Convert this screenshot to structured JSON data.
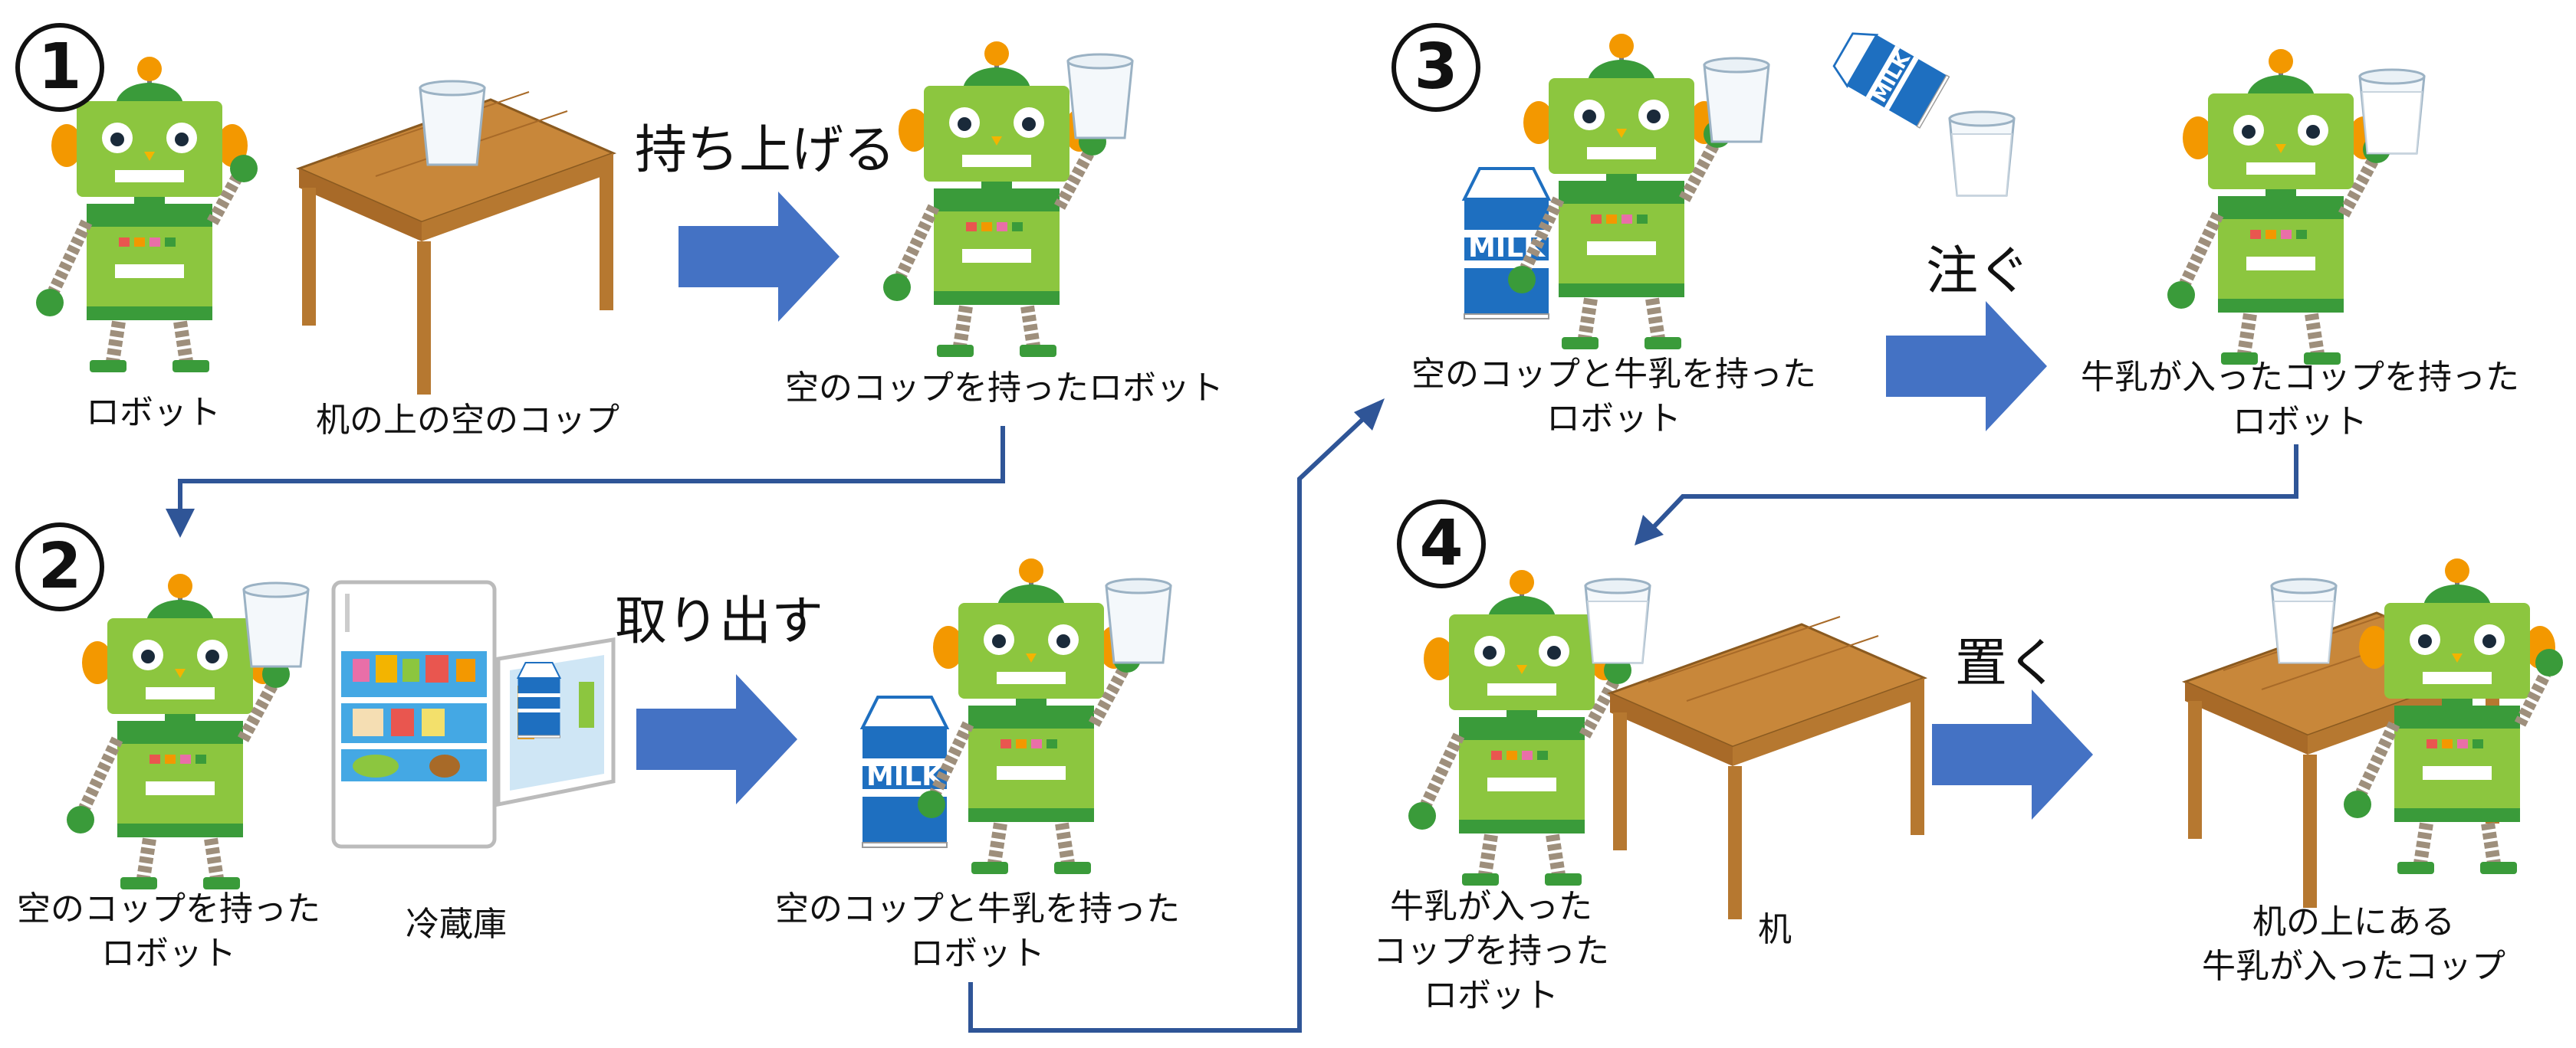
{
  "steps": {
    "s1": "1",
    "s2": "2",
    "s3": "3",
    "s4": "4"
  },
  "verbs": {
    "lift": "持ち上げる",
    "take_out": "取り出す",
    "pour": "注ぐ",
    "place": "置く"
  },
  "labels": {
    "robot": "ロボット",
    "empty_cup_on_desk": "机の上の空のコップ",
    "robot_with_empty_cup": "空のコップを持ったロボット",
    "robot_with_empty_cup_2": "空のコップを持った\nロボット",
    "fridge": "冷蔵庫",
    "robot_with_cup_and_milk": "空のコップと牛乳を持った\nロボット",
    "robot_with_cup_and_milk_3": "空のコップと牛乳を持った\nロボット",
    "robot_with_milk_cup": "牛乳が入ったコップを持った\nロボット",
    "robot_with_milk_cup_4": "牛乳が入った\nコップを持った\nロボット",
    "desk": "机",
    "milk_cup_on_desk": "机の上にある\n牛乳が入ったコップ"
  },
  "milk_text": "MILK",
  "colors": {
    "arrow_fill": "#4472c4",
    "connector": "#2f5597",
    "robot_green": "#8cc63f",
    "robot_dark_green": "#3a9b3a",
    "robot_orange": "#f39800",
    "desk_wood": "#c8873a",
    "milk_blue": "#1e6fc0"
  }
}
